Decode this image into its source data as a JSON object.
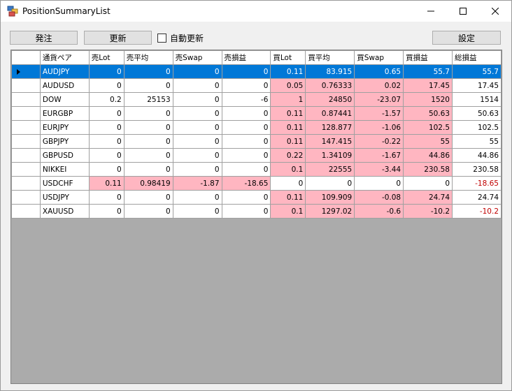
{
  "window": {
    "title": "PositionSummaryList"
  },
  "toolbar": {
    "order_label": "発注",
    "refresh_label": "更新",
    "auto_refresh_label": "自動更新",
    "settings_label": "設定"
  },
  "colors": {
    "selection": "#0078d7",
    "highlight": "#ffb6c1",
    "negative_total": "#c00000",
    "grid_empty": "#ababab"
  },
  "table": {
    "columns": [
      "通貨ペア",
      "売Lot",
      "売平均",
      "売Swap",
      "売損益",
      "買Lot",
      "買平均",
      "買Swap",
      "買損益",
      "総損益"
    ],
    "rows": [
      {
        "cells": [
          "AUDJPY",
          "0",
          "0",
          "0",
          "0",
          "0.11",
          "83.915",
          "0.65",
          "55.7",
          "55.7"
        ],
        "selected": true,
        "sell_highlight": false,
        "buy_highlight": true,
        "total_negative": false
      },
      {
        "cells": [
          "AUDUSD",
          "0",
          "0",
          "0",
          "0",
          "0.05",
          "0.76333",
          "0.02",
          "17.45",
          "17.45"
        ],
        "selected": false,
        "sell_highlight": false,
        "buy_highlight": true,
        "total_negative": false
      },
      {
        "cells": [
          "DOW",
          "0.2",
          "25153",
          "0",
          "-6",
          "1",
          "24850",
          "-23.07",
          "1520",
          "1514"
        ],
        "selected": false,
        "sell_highlight": false,
        "buy_highlight": true,
        "total_negative": false
      },
      {
        "cells": [
          "EURGBP",
          "0",
          "0",
          "0",
          "0",
          "0.11",
          "0.87441",
          "-1.57",
          "50.63",
          "50.63"
        ],
        "selected": false,
        "sell_highlight": false,
        "buy_highlight": true,
        "total_negative": false
      },
      {
        "cells": [
          "EURJPY",
          "0",
          "0",
          "0",
          "0",
          "0.11",
          "128.877",
          "-1.06",
          "102.5",
          "102.5"
        ],
        "selected": false,
        "sell_highlight": false,
        "buy_highlight": true,
        "total_negative": false
      },
      {
        "cells": [
          "GBPJPY",
          "0",
          "0",
          "0",
          "0",
          "0.11",
          "147.415",
          "-0.22",
          "55",
          "55"
        ],
        "selected": false,
        "sell_highlight": false,
        "buy_highlight": true,
        "total_negative": false
      },
      {
        "cells": [
          "GBPUSD",
          "0",
          "0",
          "0",
          "0",
          "0.22",
          "1.34109",
          "-1.67",
          "44.86",
          "44.86"
        ],
        "selected": false,
        "sell_highlight": false,
        "buy_highlight": true,
        "total_negative": false
      },
      {
        "cells": [
          "NIKKEI",
          "0",
          "0",
          "0",
          "0",
          "0.1",
          "22555",
          "-3.44",
          "230.58",
          "230.58"
        ],
        "selected": false,
        "sell_highlight": false,
        "buy_highlight": true,
        "total_negative": false
      },
      {
        "cells": [
          "USDCHF",
          "0.11",
          "0.98419",
          "-1.87",
          "-18.65",
          "0",
          "0",
          "0",
          "0",
          "-18.65"
        ],
        "selected": false,
        "sell_highlight": true,
        "buy_highlight": false,
        "total_negative": true
      },
      {
        "cells": [
          "USDJPY",
          "0",
          "0",
          "0",
          "0",
          "0.11",
          "109.909",
          "-0.08",
          "24.74",
          "24.74"
        ],
        "selected": false,
        "sell_highlight": false,
        "buy_highlight": true,
        "total_negative": false
      },
      {
        "cells": [
          "XAUUSD",
          "0",
          "0",
          "0",
          "0",
          "0.1",
          "1297.02",
          "-0.6",
          "-10.2",
          "-10.2"
        ],
        "selected": false,
        "sell_highlight": false,
        "buy_highlight": true,
        "total_negative": true
      }
    ]
  }
}
